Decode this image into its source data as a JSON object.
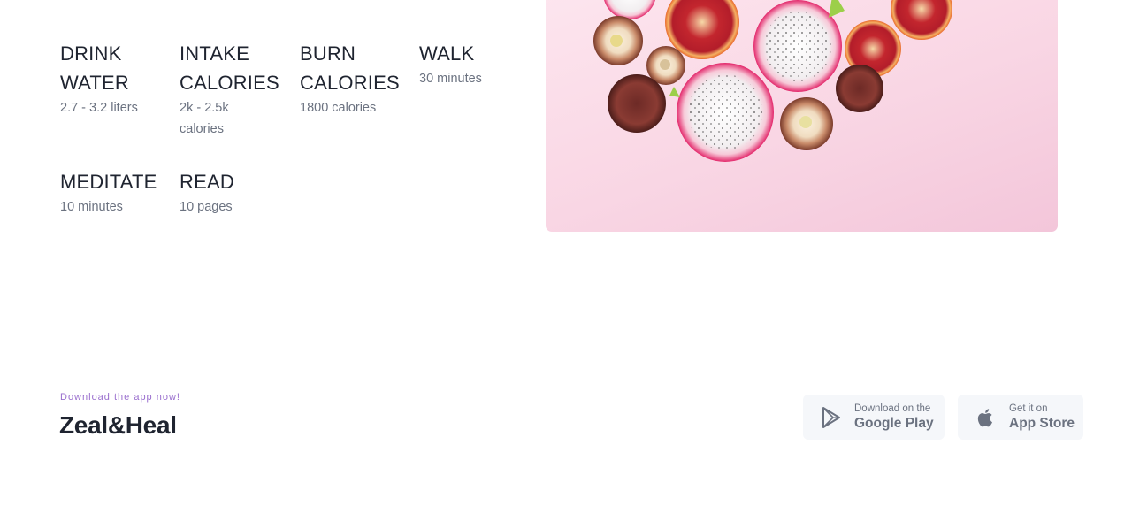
{
  "goals": [
    {
      "title_line1": "DRINK",
      "title_line2": "WATER",
      "sub_line1": "2.7 - 3.2 liters",
      "sub_line2": ""
    },
    {
      "title_line1": "INTAKE",
      "title_line2": "CALORIES",
      "sub_line1": "2k - 2.5k",
      "sub_line2": "calories"
    },
    {
      "title_line1": "BURN",
      "title_line2": "CALORIES",
      "sub_line1": "1800 calories",
      "sub_line2": ""
    },
    {
      "title_line1": "WALK",
      "title_line2": "",
      "sub_line1": "30 minutes",
      "sub_line2": ""
    },
    {
      "title_line1": "MEDITATE",
      "title_line2": "",
      "sub_line1": "10 minutes",
      "sub_line2": ""
    },
    {
      "title_line1": "READ",
      "title_line2": "",
      "sub_line1": "10 pages",
      "sub_line2": ""
    }
  ],
  "footer": {
    "tagline": "Download the app now!",
    "brand": "Zeal&Heal",
    "google_play": {
      "small": "Download on the",
      "big": "Google Play",
      "icon": "play-store-icon"
    },
    "app_store": {
      "small": "Get it on",
      "big": "App Store",
      "icon": "apple-icon"
    }
  },
  "colors": {
    "accent": "#9a6fce",
    "hero_bg": "#f9d6e4",
    "button_bg": "#f5f7fa"
  }
}
